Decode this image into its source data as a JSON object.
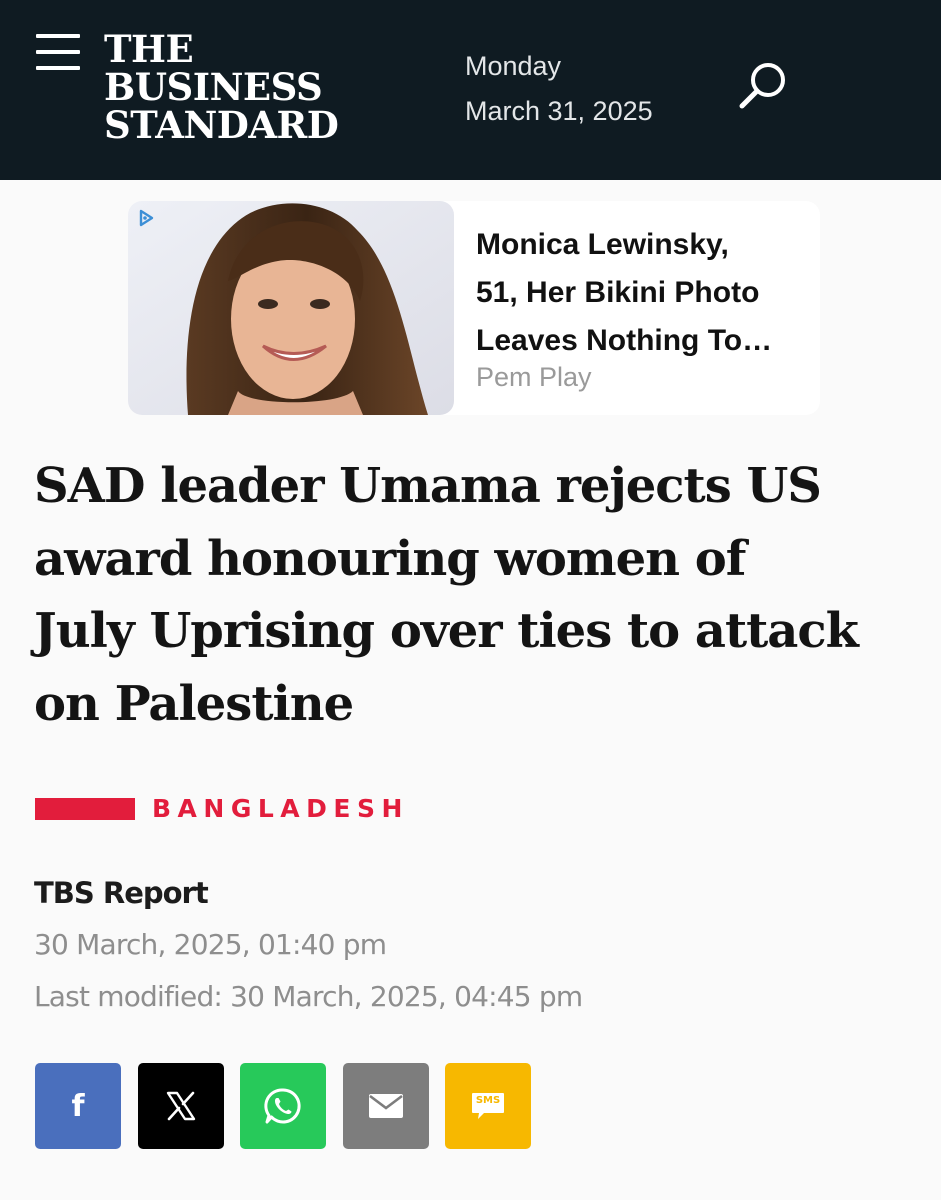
{
  "header": {
    "logo_line1": "THE",
    "logo_line2": "BUSINESS",
    "logo_line3": "STANDARD",
    "day": "Monday",
    "date": "March 31, 2025"
  },
  "ad": {
    "title_lines": [
      "Monica Lewinsky,",
      "51, Her Bikini Photo",
      "Leaves Nothing To…"
    ],
    "source": "Pem Play"
  },
  "article": {
    "headline_lines": [
      "SAD leader Umama rejects US",
      "award honouring women of",
      "July Uprising over ties to attack",
      "on Palestine"
    ],
    "category": "BANGLADESH",
    "author": "TBS Report",
    "published": "30 March, 2025, 01:40 pm",
    "modified": "Last modified: 30 March, 2025, 04:45 pm"
  },
  "share": {
    "facebook_label": "f",
    "x_label": "𝕏",
    "sms_label": "SMS"
  },
  "colors": {
    "header_bg": "#0f1b22",
    "accent": "#e21d3c",
    "facebook": "#4a6fbd",
    "whatsapp": "#27c95a",
    "email": "#7d7d7d",
    "sms": "#f7b800"
  },
  "icons": [
    "menu-icon",
    "search-icon",
    "adchoices-icon",
    "facebook-icon",
    "x-icon",
    "whatsapp-icon",
    "email-icon",
    "sms-icon"
  ]
}
